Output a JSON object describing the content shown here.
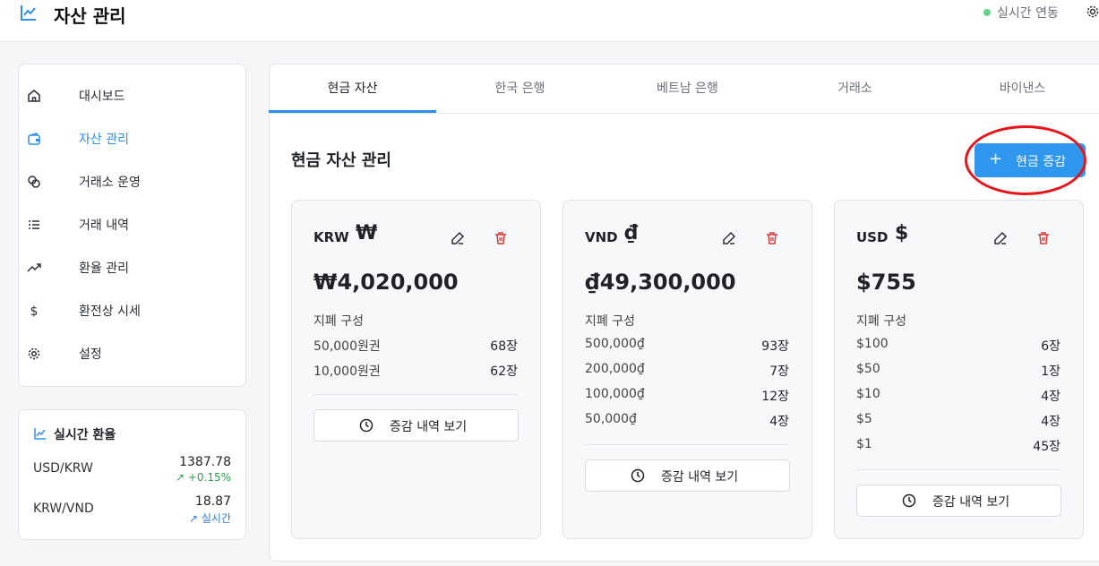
{
  "header": {
    "title": "자산 관리",
    "live_status": "실시간 연동"
  },
  "sidebar": {
    "items": [
      {
        "label": "대시보드",
        "icon": "home-icon",
        "active": false
      },
      {
        "label": "자산 관리",
        "icon": "wallet-icon",
        "active": true
      },
      {
        "label": "거래소 운영",
        "icon": "coins-icon",
        "active": false
      },
      {
        "label": "거래 내역",
        "icon": "list-icon",
        "active": false
      },
      {
        "label": "환율 관리",
        "icon": "trending-up-icon",
        "active": false
      },
      {
        "label": "환전상 시세",
        "icon": "dollar-icon",
        "active": false
      },
      {
        "label": "설정",
        "icon": "gear-icon",
        "active": false
      }
    ]
  },
  "rates": {
    "title": "실시간 환율",
    "items": [
      {
        "pair": "USD/KRW",
        "value": "1387.78",
        "change": "+0.15%",
        "change_color": "#2e9a4f"
      },
      {
        "pair": "KRW/VND",
        "value": "18.87",
        "change": "실시간",
        "change_color": "#2f7fd8"
      }
    ]
  },
  "tabs": [
    {
      "label": "현금 자산",
      "active": true
    },
    {
      "label": "한국 은행",
      "active": false
    },
    {
      "label": "베트남 은행",
      "active": false
    },
    {
      "label": "거래소",
      "active": false
    },
    {
      "label": "바이낸스",
      "active": false
    }
  ],
  "section": {
    "title": "현금 자산 관리",
    "add_button": "현금 증감"
  },
  "cards": [
    {
      "code": "KRW",
      "symbol": "₩",
      "amount": "₩4,020,000",
      "composition_label": "지폐 구성",
      "rows": [
        {
          "denom": "50,000원권",
          "count": "68장"
        },
        {
          "denom": "10,000원권",
          "count": "62장"
        }
      ],
      "history_button": "증감 내역 보기"
    },
    {
      "code": "VND",
      "symbol": "₫",
      "amount": "₫49,300,000",
      "composition_label": "지폐 구성",
      "rows": [
        {
          "denom": "500,000₫",
          "count": "93장"
        },
        {
          "denom": "200,000₫",
          "count": "7장"
        },
        {
          "denom": "100,000₫",
          "count": "12장"
        },
        {
          "denom": "50,000₫",
          "count": "4장"
        }
      ],
      "history_button": "증감 내역 보기"
    },
    {
      "code": "USD",
      "symbol": "$",
      "amount": "$755",
      "composition_label": "지폐 구성",
      "rows": [
        {
          "denom": "$100",
          "count": "6장"
        },
        {
          "denom": "$50",
          "count": "1장"
        },
        {
          "denom": "$10",
          "count": "4장"
        },
        {
          "denom": "$5",
          "count": "4장"
        },
        {
          "denom": "$1",
          "count": "45장"
        }
      ],
      "history_button": "증감 내역 보기"
    }
  ],
  "colors": {
    "accent": "#2f97ee",
    "danger": "#d63b3b",
    "highlight_ring": "#e8141b"
  }
}
